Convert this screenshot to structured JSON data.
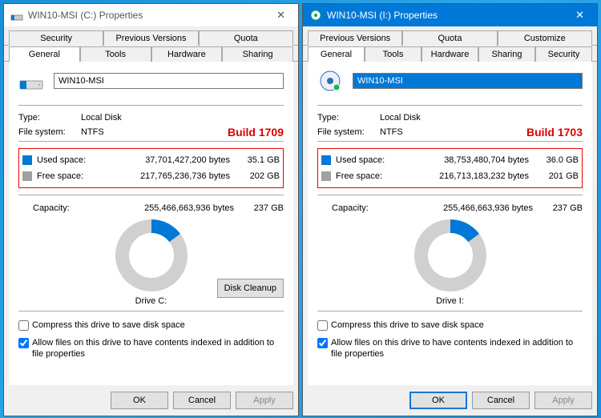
{
  "left": {
    "title": "WIN10-MSI (C:) Properties",
    "tabs_top": [
      "Security",
      "Previous Versions",
      "Quota"
    ],
    "tabs_bot": [
      "General",
      "Tools",
      "Hardware",
      "Sharing"
    ],
    "drive_name": "WIN10-MSI",
    "type_label": "Type:",
    "type_value": "Local Disk",
    "fs_label": "File system:",
    "fs_value": "NTFS",
    "build": "Build 1709",
    "used_label": "Used space:",
    "used_bytes": "37,701,427,200 bytes",
    "used_gb": "35.1 GB",
    "free_label": "Free space:",
    "free_bytes": "217,765,236,736 bytes",
    "free_gb": "202 GB",
    "cap_label": "Capacity:",
    "cap_bytes": "255,466,663,936 bytes",
    "cap_gb": "237 GB",
    "drive_caption": "Drive C:",
    "cleanup": "Disk Cleanup",
    "compress": "Compress this drive to save disk space",
    "index": "Allow files on this drive to have contents indexed in addition to file properties",
    "ok": "OK",
    "cancel": "Cancel",
    "apply": "Apply"
  },
  "right": {
    "title": "WIN10-MSI (I:) Properties",
    "tabs_top": [
      "Previous Versions",
      "Quota",
      "Customize"
    ],
    "tabs_bot": [
      "General",
      "Tools",
      "Hardware",
      "Sharing",
      "Security"
    ],
    "drive_name": "WIN10-MSI",
    "type_label": "Type:",
    "type_value": "Local Disk",
    "fs_label": "File system:",
    "fs_value": "NTFS",
    "build": "Build 1703",
    "used_label": "Used space:",
    "used_bytes": "38,753,480,704 bytes",
    "used_gb": "36.0 GB",
    "free_label": "Free space:",
    "free_bytes": "216,713,183,232 bytes",
    "free_gb": "201 GB",
    "cap_label": "Capacity:",
    "cap_bytes": "255,466,663,936 bytes",
    "cap_gb": "237 GB",
    "drive_caption": "Drive I:",
    "compress": "Compress this drive to save disk space",
    "index": "Allow files on this drive to have contents indexed in addition to file properties",
    "ok": "OK",
    "cancel": "Cancel",
    "apply": "Apply"
  },
  "chart_data": [
    {
      "type": "pie",
      "title": "Drive C:",
      "series": [
        {
          "name": "Used space",
          "value": 37701427200
        },
        {
          "name": "Free space",
          "value": 217765236736
        }
      ]
    },
    {
      "type": "pie",
      "title": "Drive I:",
      "series": [
        {
          "name": "Used space",
          "value": 38753480704
        },
        {
          "name": "Free space",
          "value": 216713183232
        }
      ]
    }
  ]
}
